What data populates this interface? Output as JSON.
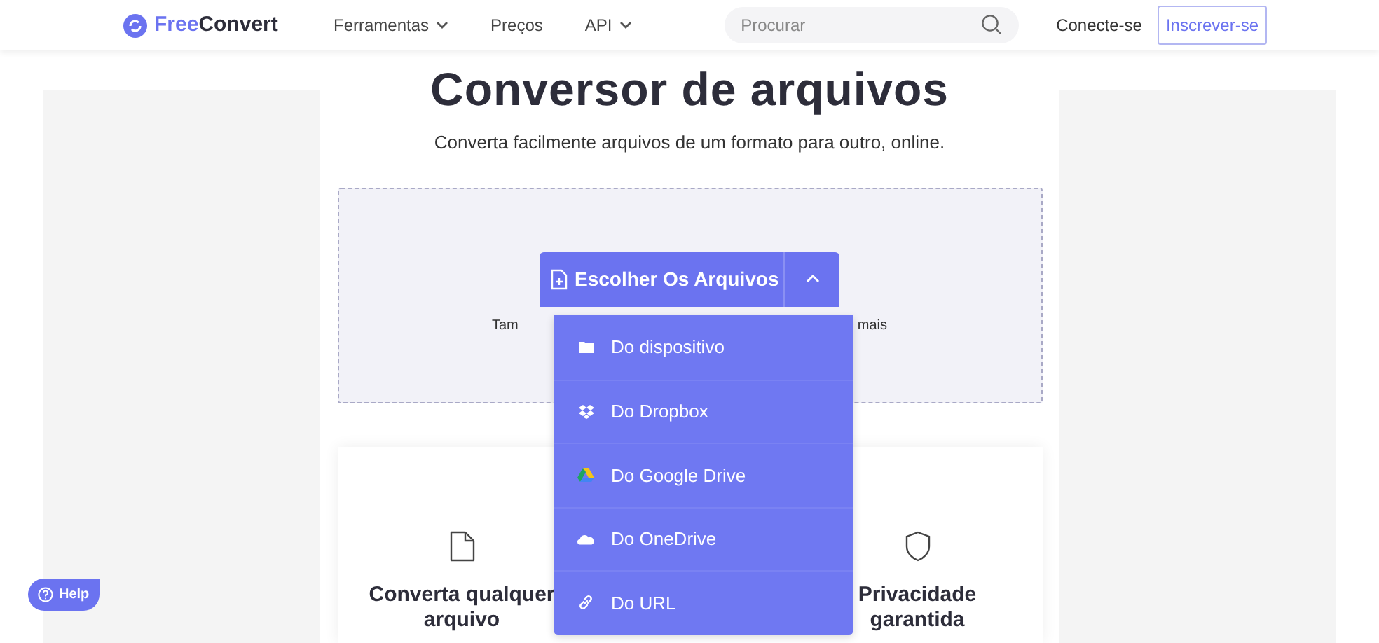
{
  "header": {
    "logo": {
      "part_1": "Free",
      "part_2": "Convert"
    },
    "nav": [
      {
        "label": "Ferramentas",
        "dropdown": true
      },
      {
        "label": "Preços",
        "dropdown": false
      },
      {
        "label": "API",
        "dropdown": true
      }
    ],
    "search": {
      "placeholder": "Procurar"
    },
    "login": "Conecte-se",
    "signup": "Inscrever-se"
  },
  "hero": {
    "title": "Conversor de arquivos",
    "subtitle": "Converta facilmente arquivos de um formato para outro, online."
  },
  "dropzone": {
    "button": "Escolher Os Arquivos",
    "menu_expanded": true,
    "hint_left": "Tam",
    "hint_right": "mais",
    "menu": [
      {
        "kind": "folder",
        "label": "Do dispositivo"
      },
      {
        "kind": "dropbox",
        "label": "Do Dropbox"
      },
      {
        "kind": "gdrive",
        "label": "Do Google Drive"
      },
      {
        "kind": "onedrive",
        "label": "Do OneDrive"
      },
      {
        "kind": "link",
        "label": "Do URL"
      }
    ]
  },
  "features": [
    {
      "kind": "file",
      "title": "Converta qualquer arquivo"
    },
    {
      "kind": "shield",
      "title": "Privacidade garantida"
    }
  ],
  "help": "Help"
}
